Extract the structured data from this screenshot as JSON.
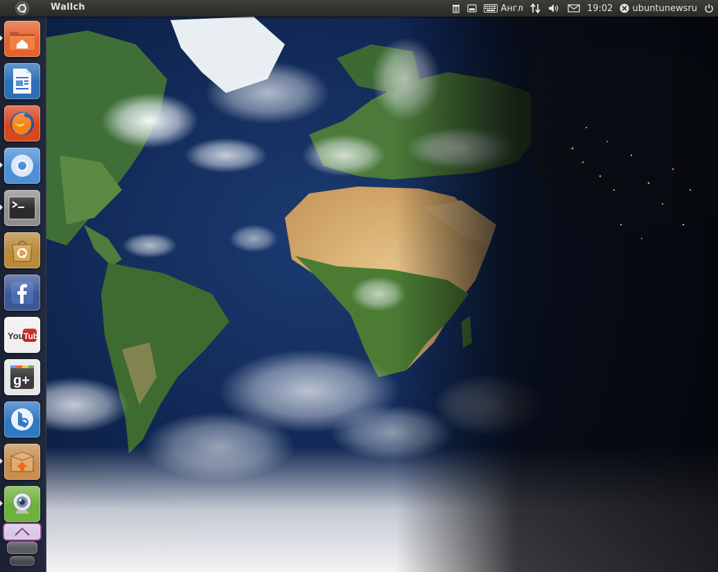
{
  "top_panel": {
    "app_title": "Wallch",
    "keyboard_layout": "Англ",
    "clock": "19:02",
    "user_name": "ubuntunewsru"
  },
  "launcher": {
    "items": [
      {
        "name": "home-folder",
        "icon": "home-folder-icon",
        "color": "#e4622b",
        "running": true
      },
      {
        "name": "libreoffice-writer",
        "icon": "writer-document-icon",
        "color": "#2c6fb7",
        "running": false
      },
      {
        "name": "firefox",
        "icon": "firefox-icon",
        "color": "#d9471f",
        "running": false
      },
      {
        "name": "chromium",
        "icon": "chromium-icon",
        "color": "#4d8fd6",
        "running": true
      },
      {
        "name": "terminal",
        "icon": "terminal-icon",
        "color": "#3a3a3a",
        "running": true
      },
      {
        "name": "ubuntu-software-center",
        "icon": "software-center-icon",
        "color": "#b98a3a",
        "running": false
      },
      {
        "name": "facebook",
        "icon": "facebook-icon",
        "color": "#3b5998",
        "running": false
      },
      {
        "name": "youtube",
        "icon": "youtube-icon",
        "color": "#c8201b",
        "running": false
      },
      {
        "name": "google-plus",
        "icon": "google-plus-icon",
        "color": "#e6e6e6",
        "running": false
      },
      {
        "name": "bing",
        "icon": "bing-icon",
        "color": "#2f78c4",
        "running": false
      },
      {
        "name": "archive-manager",
        "icon": "archive-icon",
        "color": "#c98f4e",
        "running": true
      },
      {
        "name": "cheese-webcam",
        "icon": "webcam-icon",
        "color": "#6db23b",
        "running": true
      },
      {
        "name": "stacked-app",
        "icon": "stacked-app-icon",
        "color": "#a64aa8",
        "running": false
      }
    ]
  },
  "desktop": {
    "wallpaper": "earth-day-night-map"
  }
}
